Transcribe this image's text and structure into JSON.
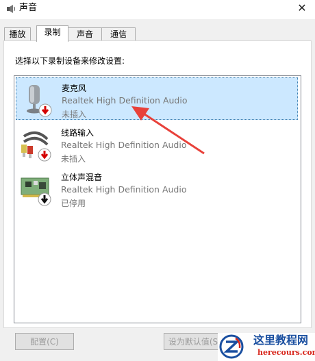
{
  "window": {
    "title": "声音",
    "close_glyph": "✕"
  },
  "tabs": [
    {
      "label": "播放",
      "active": false
    },
    {
      "label": "录制",
      "active": true
    },
    {
      "label": "声音",
      "active": false
    },
    {
      "label": "通信",
      "active": false
    }
  ],
  "panel": {
    "instruction": "选择以下录制设备来修改设置:"
  },
  "devices": [
    {
      "name": "麦克风",
      "description": "Realtek High Definition Audio",
      "status": "未插入",
      "icon": "microphone-icon",
      "badge": "down-arrow-red",
      "selected": true
    },
    {
      "name": "线路输入",
      "description": "Realtek High Definition Audio",
      "status": "未插入",
      "icon": "line-in-cable-icon",
      "badge": "down-arrow-red",
      "selected": false
    },
    {
      "name": "立体声混音",
      "description": "Realtek High Definition Audio",
      "status": "已停用",
      "icon": "sound-card-icon",
      "badge": "down-arrow-black",
      "selected": false
    }
  ],
  "buttons": {
    "configure": "配置(C)",
    "set_default": "设为默认值(S"
  },
  "watermark": {
    "title": "这里教程网",
    "url": "herecours.com"
  },
  "colors": {
    "selection": "#cce8ff",
    "annotation_arrow": "#e8413a",
    "watermark_title": "#1a4fa0",
    "watermark_url": "#d8261c"
  }
}
